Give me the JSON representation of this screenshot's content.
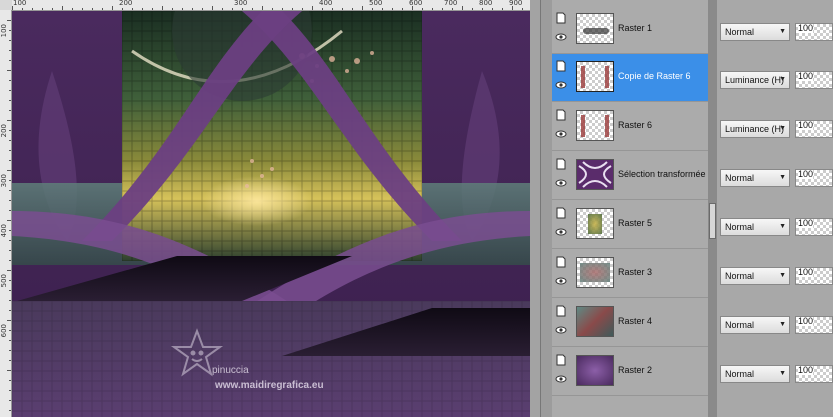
{
  "rulers": {
    "top": [
      {
        "label": "100"
      },
      {
        "label": "200"
      },
      {
        "label": "300"
      },
      {
        "label": "400"
      },
      {
        "label": "500"
      },
      {
        "label": "600"
      },
      {
        "label": "700"
      },
      {
        "label": "800"
      },
      {
        "label": "900"
      }
    ],
    "left": [
      {
        "label": "100"
      },
      {
        "label": "200"
      },
      {
        "label": "300"
      },
      {
        "label": "400"
      },
      {
        "label": "500"
      },
      {
        "label": "600"
      }
    ]
  },
  "canvas": {
    "watermark_name": "pinuccia",
    "watermark_url": "www.maidiregrafica.eu"
  },
  "layers": [
    {
      "name": "Raster 1",
      "blend": "Normal",
      "opacity": "100",
      "selected": false
    },
    {
      "name": "Copie de Raster 6",
      "blend": "Luminance (H)",
      "opacity": "100",
      "selected": true
    },
    {
      "name": "Raster 6",
      "blend": "Luminance (H)",
      "opacity": "100",
      "selected": false
    },
    {
      "name": "Sélection transformée",
      "blend": "Normal",
      "opacity": "100",
      "selected": false
    },
    {
      "name": "Raster 5",
      "blend": "Normal",
      "opacity": "100",
      "selected": false
    },
    {
      "name": "Raster 3",
      "blend": "Normal",
      "opacity": "100",
      "selected": false
    },
    {
      "name": "Raster 4",
      "blend": "Normal",
      "opacity": "100",
      "selected": false
    },
    {
      "name": "Raster 2",
      "blend": "Normal",
      "opacity": "100",
      "selected": false
    }
  ],
  "colors": {
    "selection": "#3b8fe8",
    "purple": "#5a2c6b",
    "teal": "#3f6b5a"
  },
  "icons": {
    "layer_doc": "layer-document-icon",
    "visibility": "eye-icon",
    "dropdown": "chevron-down-icon"
  }
}
